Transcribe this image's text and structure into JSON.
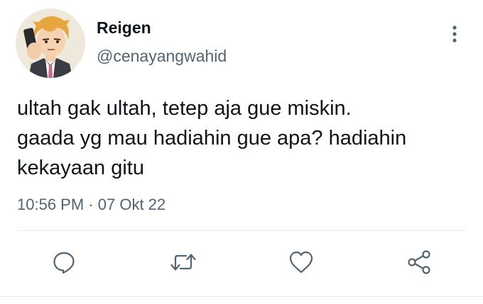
{
  "user": {
    "display_name": "Reigen",
    "handle": "@cenayangwahid"
  },
  "tweet": {
    "text": "ultah gak ultah, tetep aja gue miskin.\ngaada yg mau hadiahin gue apa? hadiahin\nkekayaan gitu",
    "time": "10:56 PM",
    "separator": "·",
    "date": "07 Okt 22"
  },
  "actions": {
    "icons": [
      "reply-icon",
      "retweet-icon",
      "like-icon",
      "share-icon"
    ]
  },
  "colors": {
    "text": "#0f1419",
    "secondary": "#536471",
    "divider": "#e6ecf0"
  }
}
